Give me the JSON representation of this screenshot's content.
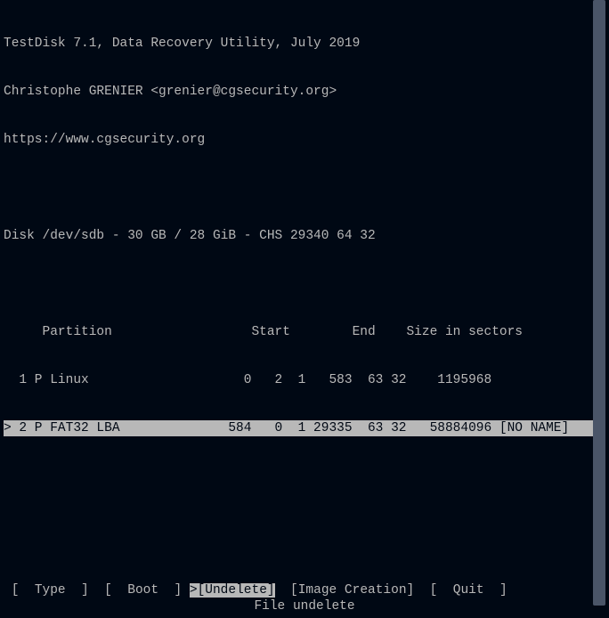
{
  "header": {
    "title": "TestDisk 7.1, Data Recovery Utility, July 2019",
    "author": "Christophe GRENIER <grenier@cgsecurity.org>",
    "url": "https://www.cgsecurity.org"
  },
  "disk_info": "Disk /dev/sdb - 30 GB / 28 GiB - CHS 29340 64 32",
  "table_header": "     Partition                  Start        End    Size in sectors",
  "partitions": [
    {
      "row": "  1 P Linux                    0   2  1   583  63 32    1195968",
      "selected": false
    },
    {
      "row": "> 2 P FAT32 LBA              584   0  1 29335  63 32   58884096 [NO NAME]",
      "selected": true
    }
  ],
  "menu": {
    "items": [
      {
        "label": "Type",
        "selected": false
      },
      {
        "label": "Boot",
        "selected": false
      },
      {
        "label": "Undelete",
        "selected": true
      },
      {
        "label": "Image Creation",
        "selected": false
      },
      {
        "label": "Quit",
        "selected": false
      }
    ],
    "hint": "File undelete"
  }
}
